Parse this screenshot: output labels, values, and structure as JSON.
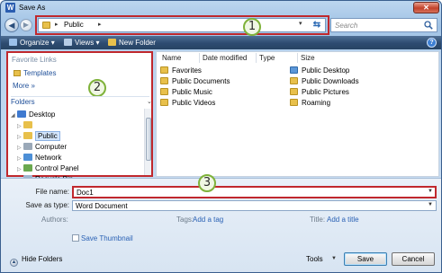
{
  "window": {
    "title": "Save As",
    "app_icon_letter": "W",
    "close_glyph": "✕"
  },
  "nav": {
    "back_glyph": "◀",
    "forward_glyph": "▶",
    "breadcrumb_sep": "▸",
    "breadcrumb": "Public",
    "dropdown_glyph": "▾",
    "refresh_glyph": "⇆",
    "search_placeholder": "Search"
  },
  "callouts": [
    "1",
    "2",
    "3"
  ],
  "toolbar": {
    "organize": "Organize",
    "views": "Views",
    "new_folder": "New Folder",
    "dropdown_glyph": "▾",
    "help": "?"
  },
  "left_pane": {
    "favorite_links_header": "Favorite Links",
    "favorites": [
      "Templates"
    ],
    "more": "More",
    "more_glyph": "»",
    "folders_header": "Folders",
    "folders_chevron": "⌄",
    "tree": [
      {
        "label": "Desktop",
        "expanded": true
      },
      {
        "label": "",
        "expanded": false
      },
      {
        "label": "Public",
        "expanded": false,
        "selected": true
      },
      {
        "label": "Computer",
        "expanded": false
      },
      {
        "label": "Network",
        "expanded": false
      },
      {
        "label": "Control Panel",
        "expanded": false
      },
      {
        "label": "Recycle Bin",
        "expanded": false
      }
    ]
  },
  "file_pane": {
    "columns": [
      "Name",
      "Date modified",
      "Type",
      "Size"
    ],
    "items_left": [
      "Favorites",
      "Public Documents",
      "Public Music",
      "Public Videos"
    ],
    "items_right": [
      "Public Desktop",
      "Public Downloads",
      "Public Pictures",
      "Roaming"
    ]
  },
  "form": {
    "file_name_label": "File name:",
    "file_name_value": "Doc1",
    "save_as_type_label": "Save as type:",
    "save_as_type_value": "Word Document",
    "authors_label": "Authors:",
    "tags_label": "Tags:",
    "tags_link": "Add a tag",
    "title_label": "Title:",
    "title_link": "Add a title",
    "save_thumbnail": "Save Thumbnail",
    "hide_folders": "Hide Folders",
    "tools": "Tools",
    "save": "Save",
    "cancel": "Cancel"
  },
  "colors": {
    "highlight": "#c0282d",
    "callout_ring": "#7fb23a",
    "link": "#2b62b5"
  }
}
